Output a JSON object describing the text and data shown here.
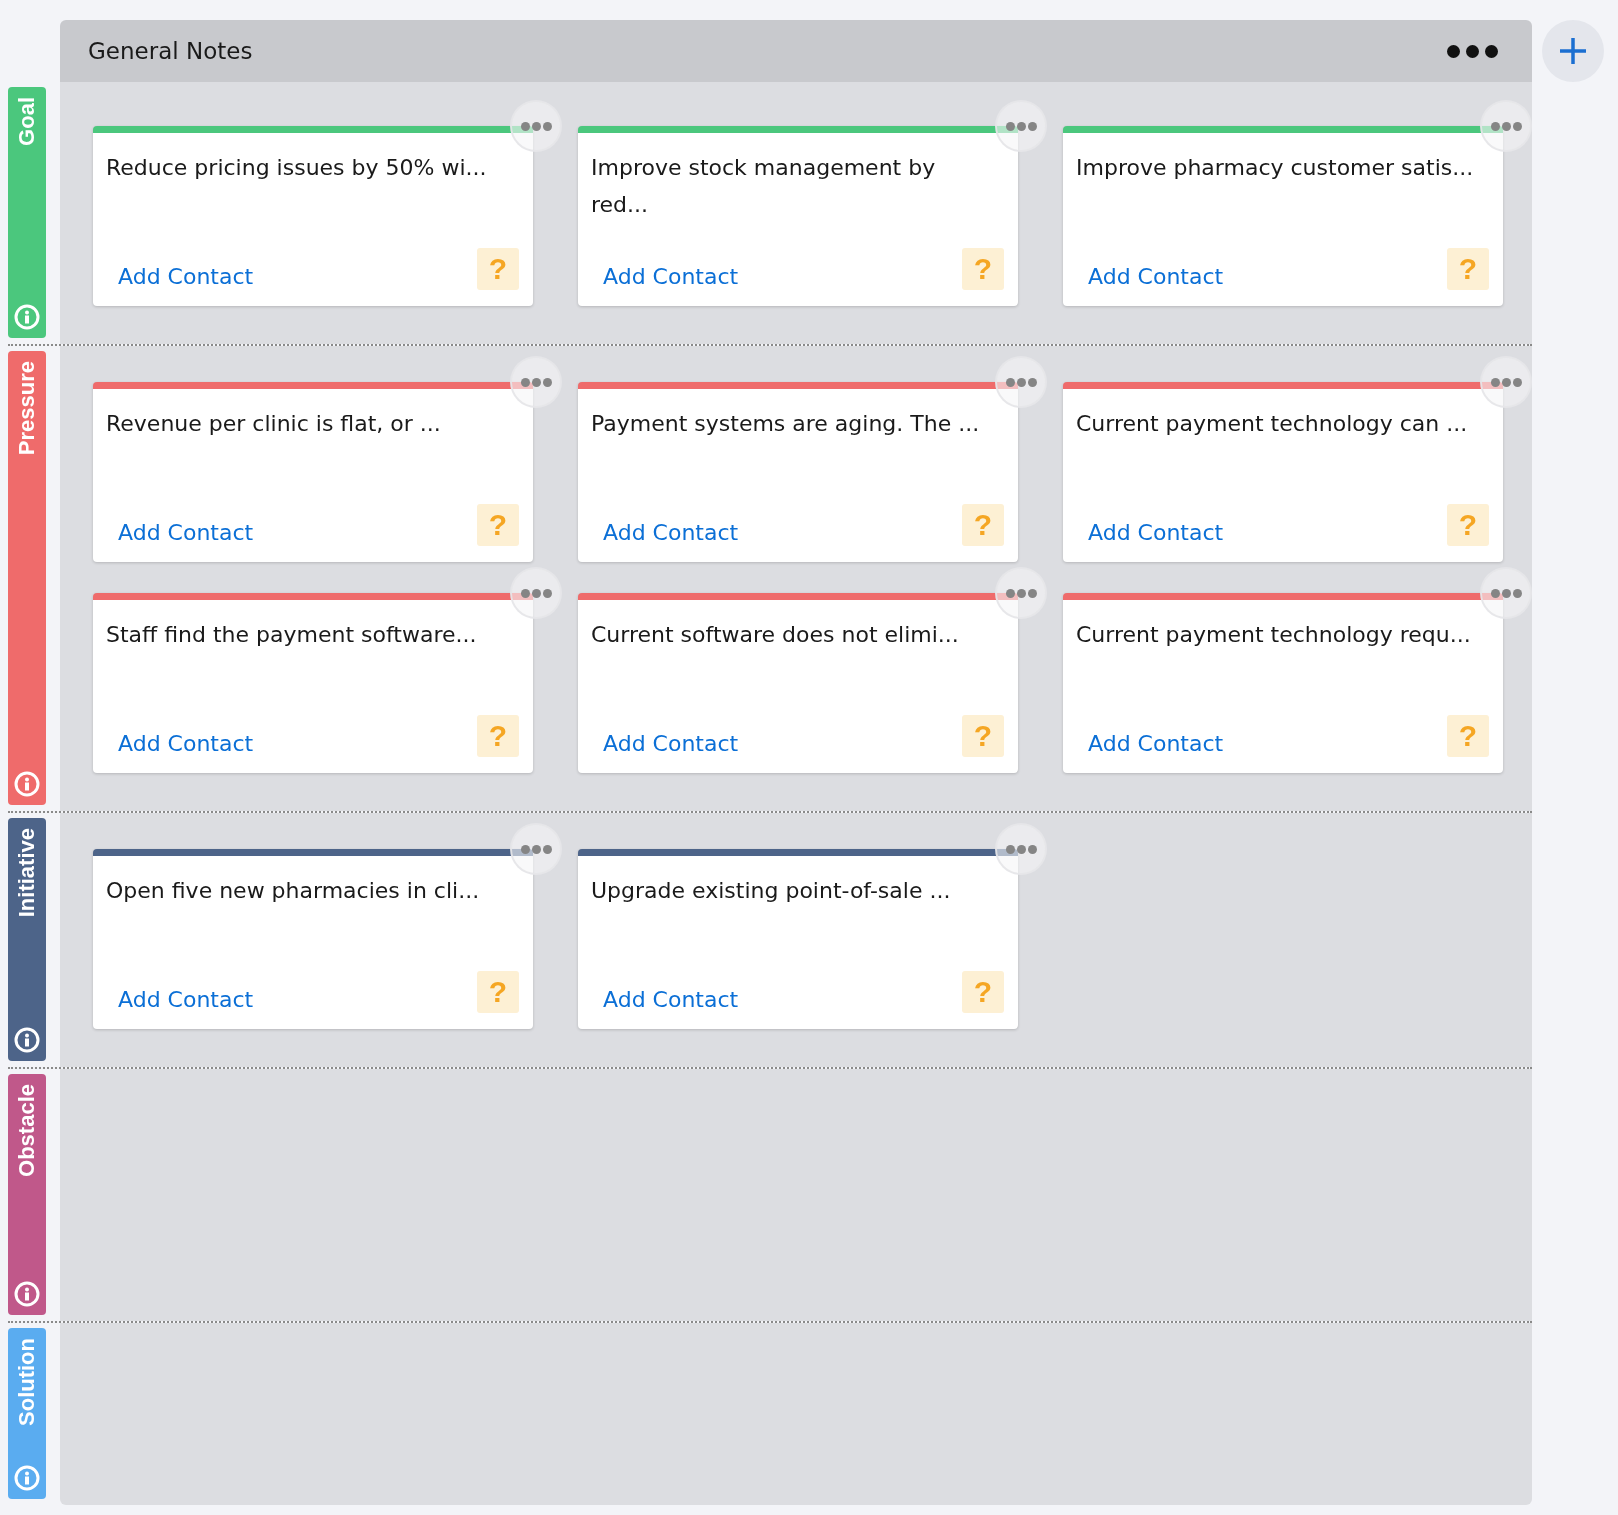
{
  "board": {
    "title": "General Notes"
  },
  "lanes": [
    {
      "label": "Goal",
      "color": "#4bc77d",
      "cards": [
        {
          "title": "Reduce pricing issues by 50% wi...",
          "link": "Add Contact",
          "help": "?"
        },
        {
          "title": "Improve stock management by red...",
          "link": "Add Contact",
          "help": "?"
        },
        {
          "title": "Improve pharmacy customer satis...",
          "link": "Add Contact",
          "help": "?"
        }
      ]
    },
    {
      "label": "Pressure",
      "color": "#ef6b6b",
      "cards": [
        {
          "title": "Revenue per clinic is flat, or ...",
          "link": "Add Contact",
          "help": "?"
        },
        {
          "title": "Payment systems are aging. The ...",
          "link": "Add Contact",
          "help": "?"
        },
        {
          "title": "Current payment technology can ...",
          "link": "Add Contact",
          "help": "?"
        },
        {
          "title": "Staff find the payment software...",
          "link": "Add Contact",
          "help": "?"
        },
        {
          "title": "Current software does not elimi...",
          "link": "Add Contact",
          "help": "?"
        },
        {
          "title": "Current payment technology requ...",
          "link": "Add Contact",
          "help": "?"
        }
      ]
    },
    {
      "label": "Initiative",
      "color": "#4d6489",
      "cards": [
        {
          "title": "Open five new pharmacies in cli...",
          "link": "Add Contact",
          "help": "?"
        },
        {
          "title": "Upgrade existing point-of-sale ...",
          "link": "Add Contact",
          "help": "?"
        }
      ]
    },
    {
      "label": "Obstacle",
      "color": "#c0588a"
    },
    {
      "label": "Solution",
      "color": "#5aacf0"
    }
  ]
}
